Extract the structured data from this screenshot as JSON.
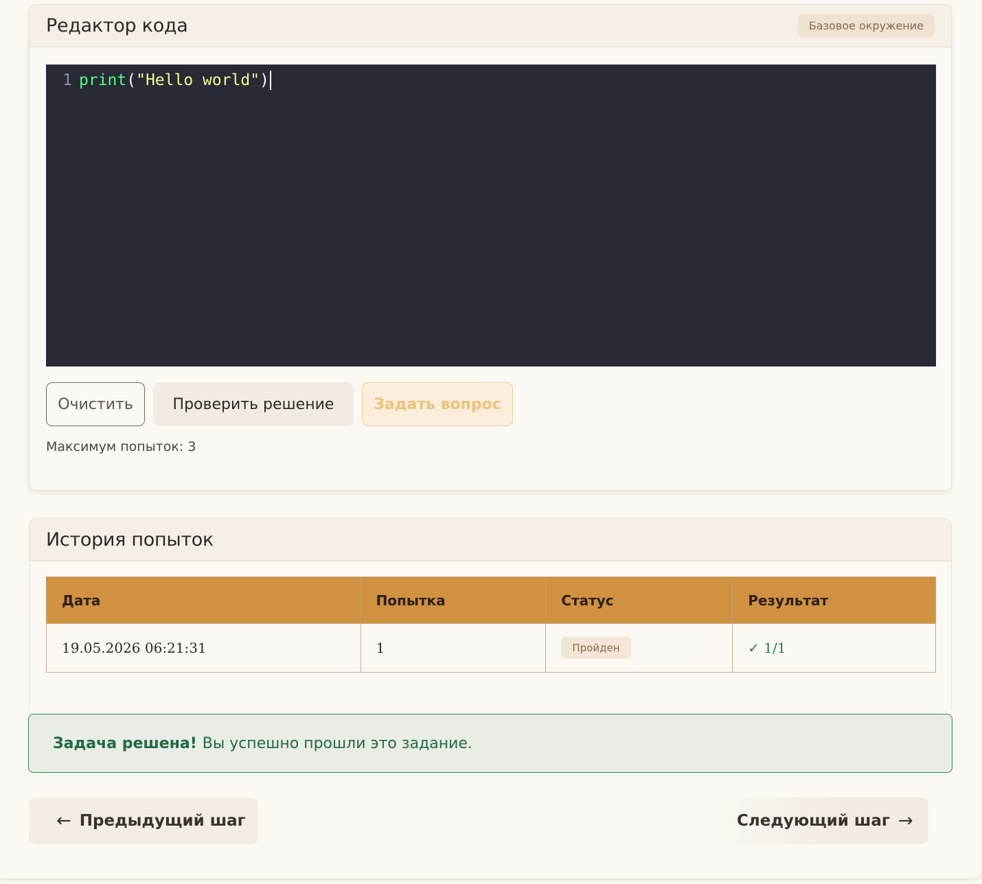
{
  "editor": {
    "title": "Редактор кода",
    "environment_badge": "Базовое окружение",
    "code_line_number": "1",
    "code_fn": "print",
    "code_open": "(",
    "code_string": "\"Hello world\"",
    "code_close": ")",
    "clear_label": "Очистить",
    "check_label": "Проверить решение",
    "ask_label": "Задать вопрос",
    "max_attempts": "Максимум попыток: 3"
  },
  "history": {
    "title": "История попыток",
    "columns": [
      "Дата",
      "Попытка",
      "Статус",
      "Результат"
    ],
    "rows": [
      {
        "date": "19.05.2026 06:21:31",
        "attempt": "1",
        "status": "Пройден",
        "result": "✓ 1/1"
      }
    ]
  },
  "alert": {
    "strong": "Задача решена!",
    "text": "Вы успешно прошли это задание."
  },
  "navigation": {
    "prev_arrow": "←",
    "prev_label": "Предыдущий шаг",
    "next_label": "Следующий шаг",
    "next_arrow": "→"
  },
  "colors": {
    "table_header": "#d09141",
    "code_bg": "#282a36",
    "success": "#2c8a5a"
  }
}
